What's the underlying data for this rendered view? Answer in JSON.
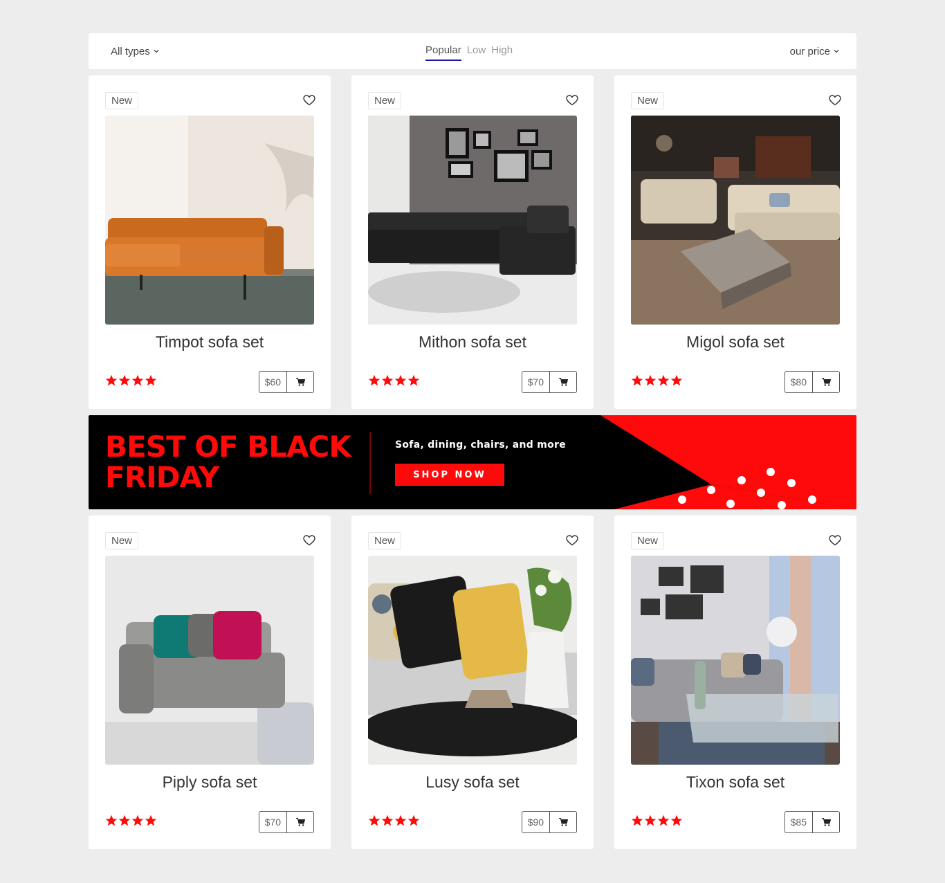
{
  "filter_bar": {
    "type_filter": "All types",
    "sort_tabs": [
      "Popular",
      "Low",
      "High"
    ],
    "active_sort": "Popular",
    "price_filter": "our price"
  },
  "colors": {
    "accent": "#1a1aa6",
    "star": "#ff0a0a",
    "banner_red": "#ff0a0a",
    "banner_bg": "#000000"
  },
  "products": [
    {
      "badge": "New",
      "name": "Timpot sofa set",
      "price": "$60",
      "rating": 4,
      "image": "orange-leather-sofa"
    },
    {
      "badge": "New",
      "name": "Mithon sofa set",
      "price": "$70",
      "rating": 4,
      "image": "black-sectional-sofa"
    },
    {
      "badge": "New",
      "name": "Migol sofa set",
      "price": "$80",
      "rating": 4,
      "image": "beige-showroom-sofas"
    },
    {
      "badge": "New",
      "name": "Piply sofa set",
      "price": "$70",
      "rating": 4,
      "image": "grey-sofa-colored-pillows"
    },
    {
      "badge": "New",
      "name": "Lusy sofa set",
      "price": "$90",
      "rating": 4,
      "image": "pillows-coffee-table"
    },
    {
      "badge": "New",
      "name": "Tixon sofa set",
      "price": "$85",
      "rating": 4,
      "image": "living-room-glass-table"
    }
  ],
  "banner": {
    "headline_line1": "BEST OF BLACK",
    "headline_line2": "FRIDAY",
    "subtitle": "Sofa, dining, chairs, and more",
    "cta": "SHOP NOW"
  },
  "icons": {
    "heart": "heart-icon",
    "cart": "cart-icon",
    "star": "star-icon",
    "chevron": "chevron-down-icon"
  }
}
